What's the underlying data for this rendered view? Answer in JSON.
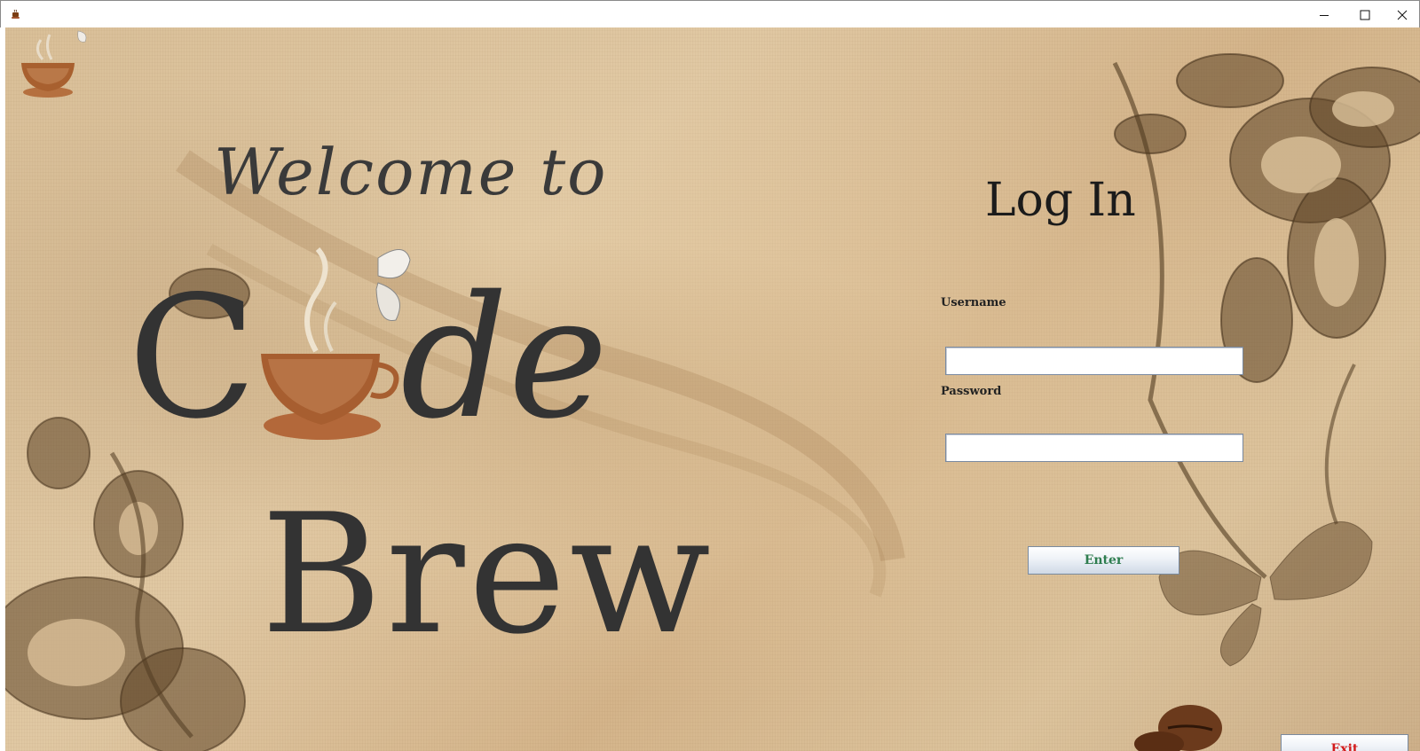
{
  "window": {
    "controls": [
      "minimize-icon",
      "maximize-icon",
      "close-icon"
    ]
  },
  "welcome": {
    "line1": "Welcome to",
    "brand_c": "C",
    "brand_de": "de",
    "brand_brew": "Brew"
  },
  "login": {
    "title": "Log In",
    "username_label": "Username",
    "username_value": "",
    "password_label": "Password",
    "password_value": "",
    "enter_label": "Enter"
  },
  "footer": {
    "exit_label": "Exit"
  },
  "colors": {
    "enter_text": "#2e7d4f",
    "exit_text": "#d21b1b",
    "heading_text": "#333333",
    "background": "#d9bf98"
  }
}
